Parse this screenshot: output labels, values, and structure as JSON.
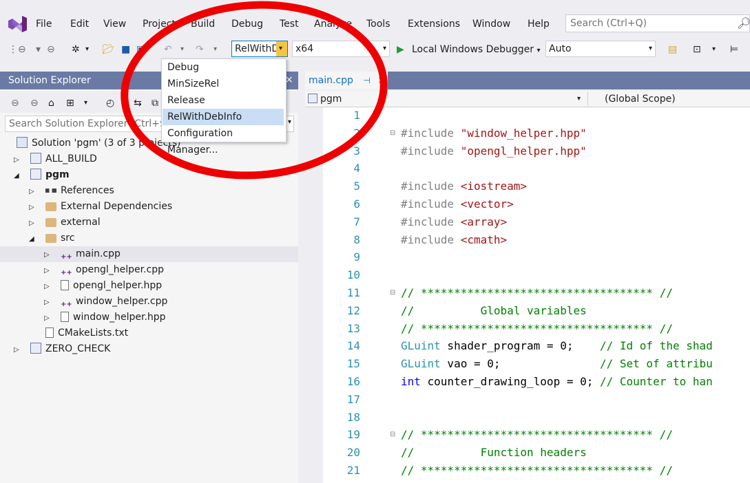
{
  "menu": [
    "File",
    "Edit",
    "View",
    "Project",
    "Build",
    "Debug",
    "Test",
    "Analyze",
    "Tools",
    "Extensions",
    "Window",
    "Help"
  ],
  "search": {
    "placeholder": "Search (Ctrl+Q)"
  },
  "toolbar": {
    "config_value": "RelWithD",
    "platform_value": "x64",
    "debugger_label": "Local Windows Debugger",
    "auto_value": "Auto"
  },
  "config_dropdown": [
    "Debug",
    "MinSizeRel",
    "Release",
    "RelWithDebInfo",
    "Configuration Manager..."
  ],
  "config_selected": "RelWithDebInfo",
  "solution_explorer": {
    "title": "Solution Explorer",
    "search_placeholder": "Search Solution Explorer (Ctrl+$)",
    "tree": [
      {
        "label": "Solution 'pgm' (3 of 3 projects)",
        "indent": 0,
        "arrow": "",
        "icon": "solution-icon"
      },
      {
        "label": "ALL_BUILD",
        "indent": 0,
        "arrow": "▷",
        "icon": "project-icon"
      },
      {
        "label": "pgm",
        "indent": 0,
        "arrow": "◢",
        "icon": "project-icon",
        "bold": true
      },
      {
        "label": "References",
        "indent": 1,
        "arrow": "▷",
        "icon": "references-icon"
      },
      {
        "label": "External Dependencies",
        "indent": 1,
        "arrow": "▷",
        "icon": "folder-icon"
      },
      {
        "label": "external",
        "indent": 1,
        "arrow": "▷",
        "icon": "folder-icon"
      },
      {
        "label": "src",
        "indent": 1,
        "arrow": "◢",
        "icon": "folder-icon"
      },
      {
        "label": "main.cpp",
        "indent": 2,
        "arrow": "▷",
        "icon": "cpp-file-icon",
        "selected": true
      },
      {
        "label": "opengl_helper.cpp",
        "indent": 2,
        "arrow": "▷",
        "icon": "cpp-file-icon"
      },
      {
        "label": "opengl_helper.hpp",
        "indent": 2,
        "arrow": "▷",
        "icon": "header-file-icon"
      },
      {
        "label": "window_helper.cpp",
        "indent": 2,
        "arrow": "▷",
        "icon": "cpp-file-icon"
      },
      {
        "label": "window_helper.hpp",
        "indent": 2,
        "arrow": "▷",
        "icon": "header-file-icon"
      },
      {
        "label": "CMakeLists.txt",
        "indent": 1,
        "arrow": "",
        "icon": "text-file-icon"
      },
      {
        "label": "ZERO_CHECK",
        "indent": 0,
        "arrow": "▷",
        "icon": "project-icon"
      }
    ]
  },
  "editor": {
    "tab": "main.cpp",
    "nav_left": "pgm",
    "nav_right": "(Global Scope)",
    "line_numbers": [
      "1",
      "2",
      "3",
      "4",
      "5",
      "6",
      "7",
      "8",
      "9",
      "10",
      "11",
      "12",
      "13",
      "14",
      "15",
      "16",
      "17",
      "18",
      "19",
      "20",
      "21"
    ]
  },
  "colors": {
    "accent": "#007acc",
    "title_bar": "#6b7aa4",
    "annotation": "#ef0000"
  }
}
